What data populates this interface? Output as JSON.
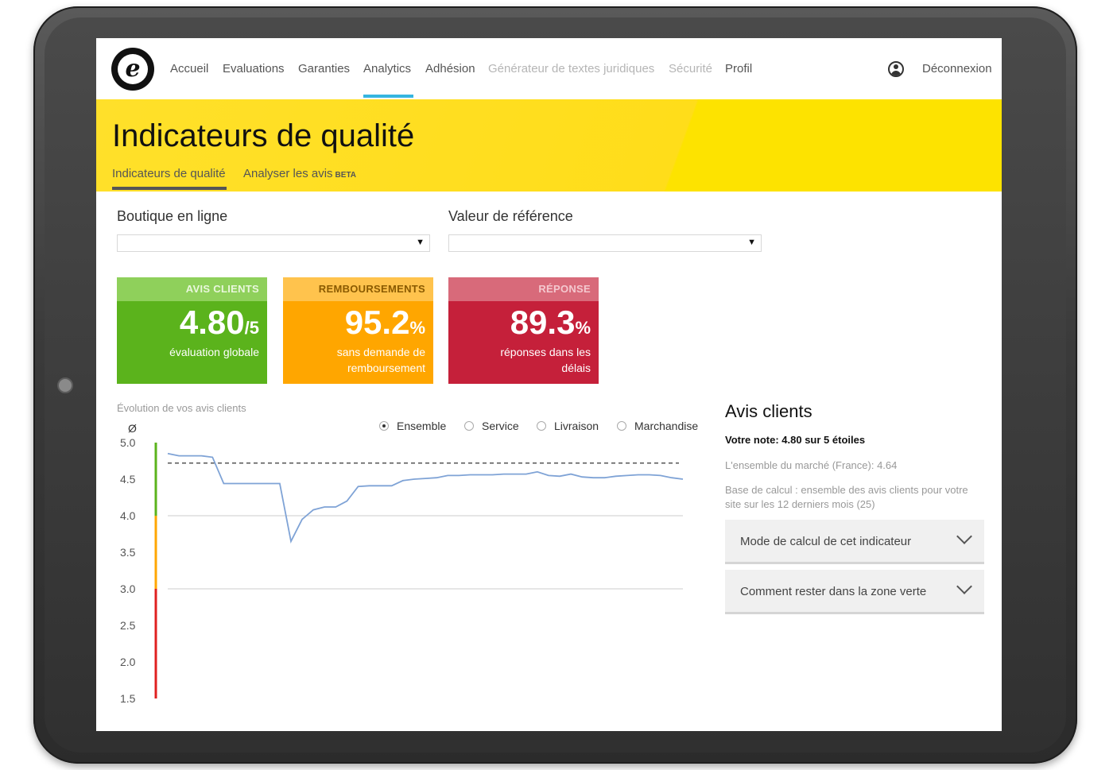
{
  "nav": {
    "items": [
      {
        "label": "Accueil",
        "state": "normal"
      },
      {
        "label": "Evaluations",
        "state": "normal"
      },
      {
        "label": "Garanties",
        "state": "normal"
      },
      {
        "label": "Analytics",
        "state": "active"
      },
      {
        "label": "Adhésion",
        "state": "normal"
      },
      {
        "label": "Générateur de textes juridiques",
        "state": "muted"
      },
      {
        "label": "Sécurité",
        "state": "muted"
      },
      {
        "label": "Profil",
        "state": "normal"
      }
    ],
    "logout": "Déconnexion",
    "logo_letter": "e"
  },
  "banner": {
    "title": "Indicateurs de qualité",
    "subtabs": [
      "Indicateurs de qualité",
      "Analyser les avis"
    ],
    "beta": "BETA"
  },
  "filters": {
    "shop_label": "Boutique en ligne",
    "reference_label": "Valeur de référence",
    "shop_value": "",
    "reference_value": ""
  },
  "kpis": [
    {
      "head": "AVIS CLIENTS",
      "value": "4.80",
      "unit": "/5",
      "desc": "évaluation globale",
      "color": "#5bb31c"
    },
    {
      "head": "REMBOURSEMENTS",
      "value": "95.2",
      "unit": "%",
      "desc": "sans demande de remboursement",
      "color": "#ffa600"
    },
    {
      "head": "RÉPONSE",
      "value": "89.3",
      "unit": "%",
      "desc": "réponses dans les délais",
      "color": "#c5203a"
    }
  ],
  "chart_title": "Évolution de vos avis clients",
  "radios": [
    {
      "label": "Ensemble",
      "checked": true
    },
    {
      "label": "Service",
      "checked": false
    },
    {
      "label": "Livraison",
      "checked": false
    },
    {
      "label": "Marchandise",
      "checked": false
    }
  ],
  "chart_data": {
    "type": "line",
    "title": "Évolution de vos avis clients",
    "ylabel": "Ø",
    "yticks": [
      "5.0",
      "4.5",
      "4.0",
      "3.5",
      "3.0",
      "2.5",
      "2.0",
      "1.5"
    ],
    "ylim": [
      1.5,
      5.0
    ],
    "reference_line": 4.72,
    "zones": [
      {
        "from": 4.0,
        "to": 5.0,
        "color": "#5bb31c"
      },
      {
        "from": 3.0,
        "to": 4.0,
        "color": "#ffa600"
      },
      {
        "from": 1.5,
        "to": 3.0,
        "color": "#e02020"
      }
    ],
    "series": [
      {
        "values": [
          4.85,
          4.82,
          4.82,
          4.82,
          4.8,
          4.44,
          4.44,
          4.44,
          4.44,
          4.44,
          4.44,
          3.65,
          3.95,
          4.08,
          4.12,
          4.12,
          4.2,
          4.4,
          4.41,
          4.41,
          4.41,
          4.48,
          4.5,
          4.51,
          4.52,
          4.55,
          4.55,
          4.56,
          4.56,
          4.56,
          4.57,
          4.57,
          4.57,
          4.6,
          4.55,
          4.54,
          4.57,
          4.53,
          4.52,
          4.52,
          4.54,
          4.55,
          4.56,
          4.56,
          4.55,
          4.52,
          4.5
        ],
        "color": "#7fa3d6"
      }
    ],
    "gridlines": [
      4.0,
      3.0
    ]
  },
  "right_panel": {
    "title": "Avis clients",
    "note_prefix": "Votre note:",
    "note_value": "4.80 sur 5 étoiles",
    "market": "L'ensemble du marché (France): 4.64",
    "base": "Base de calcul : ensemble des avis clients pour votre site sur les 12 derniers mois (25)",
    "accordions": [
      "Mode de calcul de cet indicateur",
      "Comment rester dans la zone verte"
    ]
  }
}
